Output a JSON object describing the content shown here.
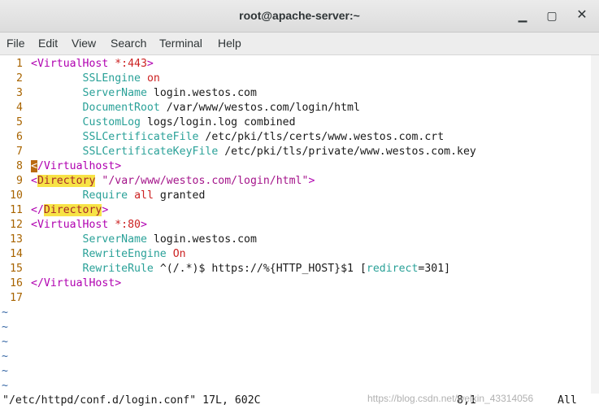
{
  "window": {
    "title": "root@apache-server:~",
    "min_glyph": "▁",
    "max_glyph": "▢",
    "close_glyph": "✕"
  },
  "menu": [
    "File",
    "Edit",
    "View",
    "Search",
    "Terminal",
    "Help"
  ],
  "lines": [
    {
      "n": "1",
      "segs": [
        [
          "tag",
          "<VirtualHost "
        ],
        [
          "red",
          "*:443"
        ],
        [
          "tag",
          ">"
        ]
      ]
    },
    {
      "n": "2",
      "segs": [
        [
          "plain",
          "        "
        ],
        [
          "kw",
          "SSLEngine"
        ],
        [
          "plain",
          " "
        ],
        [
          "red",
          "on"
        ]
      ]
    },
    {
      "n": "3",
      "segs": [
        [
          "plain",
          "        "
        ],
        [
          "kw",
          "ServerName"
        ],
        [
          "plain",
          " login.westos.com"
        ]
      ]
    },
    {
      "n": "4",
      "segs": [
        [
          "plain",
          "        "
        ],
        [
          "kw",
          "DocumentRoot"
        ],
        [
          "plain",
          " /var/www/westos.com/login/html"
        ]
      ]
    },
    {
      "n": "5",
      "segs": [
        [
          "plain",
          "        "
        ],
        [
          "kw",
          "CustomLog"
        ],
        [
          "plain",
          " logs/login.log combined"
        ]
      ]
    },
    {
      "n": "6",
      "segs": [
        [
          "plain",
          "        "
        ],
        [
          "kw",
          "SSLCertificateFile"
        ],
        [
          "plain",
          " /etc/pki/tls/certs/www.westos.com.crt"
        ]
      ]
    },
    {
      "n": "7",
      "segs": [
        [
          "plain",
          "        "
        ],
        [
          "kw",
          "SSLCertificateKeyFile"
        ],
        [
          "plain",
          " /etc/pki/tls/private/www.westos.com.key"
        ]
      ]
    },
    {
      "n": "8",
      "segs": [
        [
          "cursor",
          "<"
        ],
        [
          "tag",
          "/Virtualhost>"
        ]
      ]
    },
    {
      "n": "9",
      "segs": [
        [
          "tag",
          "<"
        ],
        [
          "hl",
          "Directory"
        ],
        [
          "plain",
          " "
        ],
        [
          "tag2",
          "\"/var/www/westos.com/login/html\""
        ],
        [
          "tag",
          ">"
        ]
      ]
    },
    {
      "n": "10",
      "segs": [
        [
          "plain",
          "        "
        ],
        [
          "kw",
          "Require"
        ],
        [
          "plain",
          " "
        ],
        [
          "red",
          "all"
        ],
        [
          "plain",
          " granted"
        ]
      ]
    },
    {
      "n": "11",
      "segs": [
        [
          "tag",
          "</"
        ],
        [
          "hl",
          "Directory"
        ],
        [
          "tag",
          ">"
        ]
      ]
    },
    {
      "n": "12",
      "segs": [
        [
          "tag",
          "<VirtualHost "
        ],
        [
          "red",
          "*:80"
        ],
        [
          "tag",
          ">"
        ]
      ]
    },
    {
      "n": "13",
      "segs": [
        [
          "plain",
          "        "
        ],
        [
          "kw",
          "ServerName"
        ],
        [
          "plain",
          " login.westos.com"
        ]
      ]
    },
    {
      "n": "14",
      "segs": [
        [
          "plain",
          "        "
        ],
        [
          "kw",
          "RewriteEngine"
        ],
        [
          "plain",
          " "
        ],
        [
          "red",
          "On"
        ]
      ]
    },
    {
      "n": "15",
      "segs": [
        [
          "plain",
          "        "
        ],
        [
          "kw",
          "RewriteRule"
        ],
        [
          "plain",
          " ^(/.*)$ https://%{HTTP_HOST}$1 ["
        ],
        [
          "kw",
          "redirect"
        ],
        [
          "plain",
          "=301]"
        ]
      ]
    },
    {
      "n": "16",
      "segs": [
        [
          "tag",
          "</VirtualHost>"
        ]
      ]
    },
    {
      "n": "17",
      "segs": []
    }
  ],
  "tilde_lines": [
    "~",
    "~",
    "~",
    "~",
    "~",
    "~"
  ],
  "status": {
    "file": "\"/etc/httpd/conf.d/login.conf\" 17L, 602C",
    "position": "8,1",
    "scroll": "All"
  },
  "watermark": "https://blog.csdn.net/weixin_43314056",
  "colors": {
    "keyword": "#2aa198",
    "tag": "#b000b0",
    "value": "#cc2222",
    "line_number": "#a86400",
    "highlight": "#f7e346",
    "cursor": "#ba6a10"
  }
}
